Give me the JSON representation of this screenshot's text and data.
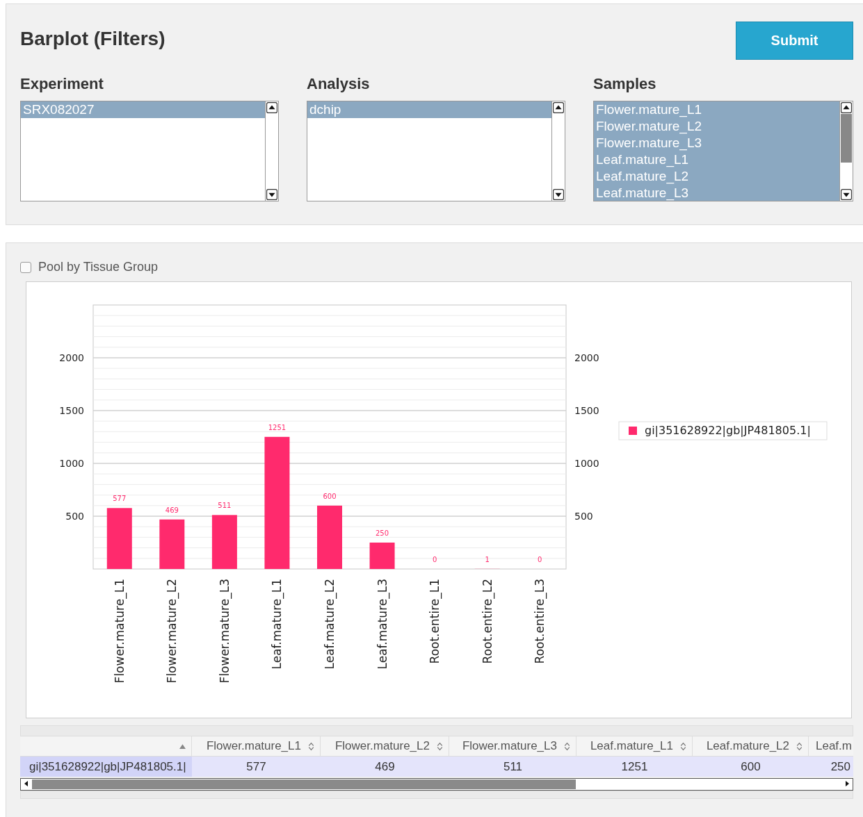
{
  "title": "Barplot (Filters)",
  "submit": "Submit",
  "lists": [
    {
      "label": "Experiment",
      "items": [
        {
          "text": "SRX082027",
          "selected": true
        }
      ]
    },
    {
      "label": "Analysis",
      "items": [
        {
          "text": "dchip",
          "selected": true
        }
      ]
    },
    {
      "label": "Samples",
      "items": [
        {
          "text": "Flower.mature_L1",
          "selected": true
        },
        {
          "text": "Flower.mature_L2",
          "selected": true
        },
        {
          "text": "Flower.mature_L3",
          "selected": true
        },
        {
          "text": "Leaf.mature_L1",
          "selected": true
        },
        {
          "text": "Leaf.mature_L2",
          "selected": true
        },
        {
          "text": "Leaf.mature_L3",
          "selected": true
        }
      ]
    }
  ],
  "pool": {
    "label": "Pool by Tissue Group",
    "checked": false
  },
  "chart_data": {
    "type": "bar",
    "categories": [
      "Flower.mature_L1",
      "Flower.mature_L2",
      "Flower.mature_L3",
      "Leaf.mature_L1",
      "Leaf.mature_L2",
      "Leaf.mature_L3",
      "Root.entire_L1",
      "Root.entire_L2",
      "Root.entire_L3"
    ],
    "series": [
      {
        "name": "gi|351628922|gb|JP481805.1|",
        "color": "#ff2a6d",
        "values": [
          577,
          469,
          511,
          1251,
          600,
          250,
          0,
          1,
          0
        ]
      }
    ],
    "ylim": [
      0,
      2500
    ],
    "yticks": [
      500,
      1000,
      1500,
      2000
    ],
    "data_labels": true,
    "grid": true
  },
  "left_axis": {
    "labels": [
      "2000",
      "1500",
      "1000",
      "500"
    ]
  },
  "table": {
    "columns": [
      "",
      "Flower.mature_L1",
      "Flower.mature_L2",
      "Flower.mature_L3",
      "Leaf.mature_L1",
      "Leaf.mature_L2",
      "Leaf.m"
    ],
    "rows": [
      [
        "gi|351628922|gb|JP481805.1|",
        "577",
        "469",
        "511",
        "1251",
        "600",
        "250"
      ]
    ]
  }
}
